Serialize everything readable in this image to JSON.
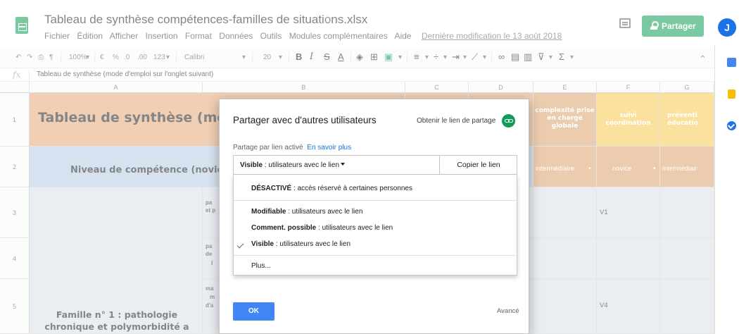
{
  "header": {
    "title": "Tableau de synthèse compétences-familles de situations.xlsx",
    "menu": [
      "Fichier",
      "Édition",
      "Afficher",
      "Insertion",
      "Format",
      "Données",
      "Outils",
      "Modules complémentaires",
      "Aide"
    ],
    "last_edit": "Dernière modification le 13 août 2018",
    "share_label": "Partager",
    "avatar_initial": "J"
  },
  "toolbar": {
    "zoom": "100%",
    "currency": "€",
    "percent": "%",
    "decimal_less": ".0",
    "decimal_more": ".00",
    "number_format": "123",
    "font": "Calibri",
    "font_size": "20",
    "bold": "B",
    "italic": "I",
    "strike": "S",
    "text_color": "A",
    "sum": "Σ"
  },
  "formula_bar": {
    "fx": "fx",
    "content": "Tableau de synthèse (mode d'emploi sur l'onglet suivant)"
  },
  "grid": {
    "columns": [
      "A",
      "B",
      "C",
      "D",
      "E",
      "F",
      "G"
    ],
    "rows": [
      "1",
      "2",
      "3",
      "4",
      "5"
    ],
    "a1": "Tableau de synthèse (mode d",
    "a2": "Niveau de compétence (novic",
    "a5_line1": "Famille n° 1 : pathologie",
    "a5_line2": "chronique et polymorbidité a",
    "b3_line1": "pa",
    "b3_line2": "et p",
    "b4_line1": "pa",
    "b4_line2": "de",
    "b4_line3": "I",
    "b5_line1": "ma",
    "b5_line2": "m",
    "b5_line3": "d'a",
    "e1": "complexité prise en charge globale",
    "f1": "suivi coordination",
    "g1": "préventi éducatio",
    "e2": "intermédiaire",
    "f2": "novice",
    "g2": "intermédiair",
    "f3": "V1",
    "f5": "V4"
  },
  "dialog": {
    "title": "Partager avec d'autres utilisateurs",
    "get_link": "Obtenir le lien de partage",
    "link_status": "Partage par lien activé",
    "learn_more": "En savoir plus",
    "select_bold": "Visible",
    "select_rest": " : utilisateurs avec le lien",
    "copy_link": "Copier le lien",
    "options": [
      {
        "bold": "DÉSACTIVÉ",
        "rest": " : accès réservé à certaines personnes"
      },
      {
        "bold": "Modifiable",
        "rest": " : utilisateurs avec le lien"
      },
      {
        "bold": "Comment. possible",
        "rest": " : utilisateurs avec le lien"
      },
      {
        "bold": "Visible",
        "rest": " : utilisateurs avec le lien"
      },
      {
        "bold": "",
        "rest": "Plus..."
      }
    ],
    "ok": "OK",
    "advanced": "Avancé"
  },
  "colors": {
    "sheets_green": "#0f9d58",
    "header_orange": "#e4a878",
    "level_blue": "#b7cae4",
    "competence_yellow": "#f6c94e",
    "ok_blue": "#4285f4"
  }
}
